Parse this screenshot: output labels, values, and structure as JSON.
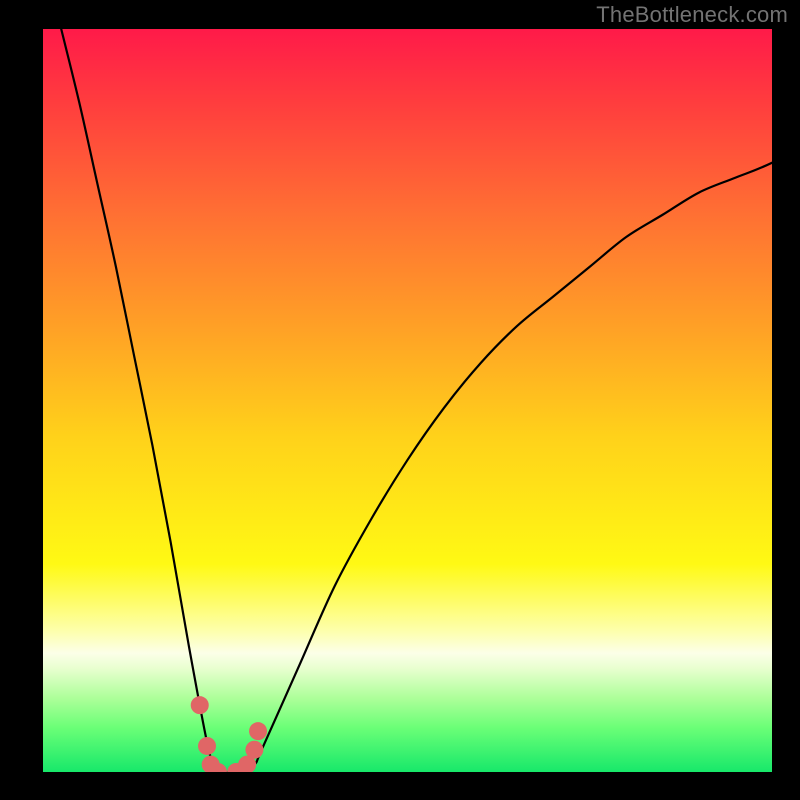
{
  "watermark": "TheBottleneck.com",
  "chart_data": {
    "type": "line",
    "title": "",
    "xlabel": "",
    "ylabel": "",
    "ylim": [
      0,
      100
    ],
    "xlim": [
      0,
      100
    ],
    "series": [
      {
        "name": "bottleneck-curve",
        "x": [
          0,
          2.5,
          5,
          7.5,
          10,
          12.5,
          15,
          17.5,
          20,
          22.5,
          23.5,
          25,
          27,
          29,
          30,
          35,
          40,
          45,
          50,
          55,
          60,
          65,
          70,
          75,
          80,
          85,
          90,
          95,
          100,
          110
        ],
        "y": [
          110,
          100,
          90,
          79,
          68,
          56,
          44,
          31,
          17,
          4,
          1,
          0,
          0,
          1,
          3,
          14,
          25,
          34,
          42,
          49,
          55,
          60,
          64,
          68,
          72,
          75,
          78,
          80,
          82,
          87
        ]
      }
    ],
    "markers": {
      "name": "highlight-points",
      "x": [
        21.5,
        22.5,
        23.0,
        24.0,
        26.5,
        28.0,
        29.0,
        29.5
      ],
      "y": [
        9.0,
        3.5,
        1.0,
        0.0,
        0.0,
        1.0,
        3.0,
        5.5
      ]
    },
    "background_gradient": {
      "stops": [
        {
          "pct": 0,
          "color": "#ff1a49"
        },
        {
          "pct": 10,
          "color": "#ff3d3e"
        },
        {
          "pct": 25,
          "color": "#ff7033"
        },
        {
          "pct": 40,
          "color": "#ffa026"
        },
        {
          "pct": 55,
          "color": "#ffd21a"
        },
        {
          "pct": 72,
          "color": "#fff914"
        },
        {
          "pct": 81,
          "color": "#fdffac"
        },
        {
          "pct": 84,
          "color": "#fcffe8"
        },
        {
          "pct": 86,
          "color": "#e9ffd0"
        },
        {
          "pct": 90,
          "color": "#aeff9a"
        },
        {
          "pct": 94,
          "color": "#6bff77"
        },
        {
          "pct": 100,
          "color": "#17e86a"
        }
      ]
    },
    "curve_stroke": "#000000",
    "marker_color": "#e06666",
    "marker_radius": 9
  }
}
